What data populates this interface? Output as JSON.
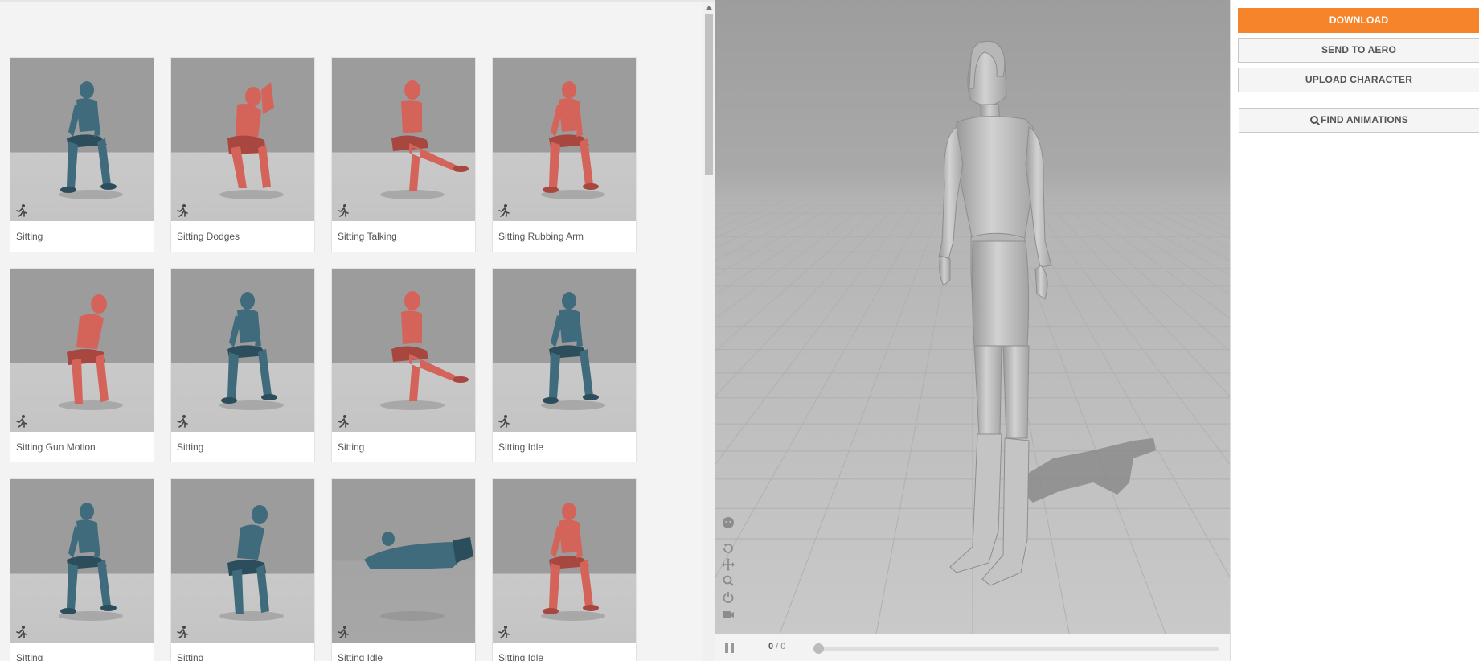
{
  "animations": [
    {
      "label": "Sitting",
      "color": "teal",
      "pose": "sit",
      "scene": "light"
    },
    {
      "label": "Sitting Dodges",
      "color": "red",
      "pose": "dodge",
      "scene": "light"
    },
    {
      "label": "Sitting Talking",
      "color": "red",
      "pose": "cross",
      "scene": "light"
    },
    {
      "label": "Sitting Rubbing Arm",
      "color": "red",
      "pose": "sit",
      "scene": "light"
    },
    {
      "label": "Sitting Gun Motion",
      "color": "red",
      "pose": "lean",
      "scene": "light"
    },
    {
      "label": "Sitting",
      "color": "teal",
      "pose": "sit",
      "scene": "light"
    },
    {
      "label": "Sitting",
      "color": "red",
      "pose": "cross",
      "scene": "light"
    },
    {
      "label": "Sitting Idle",
      "color": "teal",
      "pose": "sit",
      "scene": "light"
    },
    {
      "label": "Sitting",
      "color": "teal",
      "pose": "sit",
      "scene": "light"
    },
    {
      "label": "Sitting",
      "color": "teal",
      "pose": "lean",
      "scene": "light"
    },
    {
      "label": "Sitting Idle",
      "color": "teal",
      "pose": "lying",
      "scene": "dark"
    },
    {
      "label": "Sitting Idle",
      "color": "red",
      "pose": "sit",
      "scene": "light"
    }
  ],
  "colors": {
    "teal": "#3f6b7d",
    "teal_dark": "#2c4d5b",
    "red": "#d4645a",
    "red_dark": "#a8473f",
    "accent": "#f5842a"
  },
  "card_icon": "running-figure-icon",
  "player": {
    "current_frame": "0",
    "separator": " / ",
    "total_frames": "0",
    "progress": 0
  },
  "viewport_tools": [
    "face-icon",
    "rotate-icon",
    "move-icon",
    "zoom-icon",
    "power-icon",
    "camera-icon"
  ],
  "actions": {
    "download": "DOWNLOAD",
    "send_to_aero": "SEND TO AERO",
    "upload_character": "UPLOAD CHARACTER",
    "find_animations": "FIND ANIMATIONS"
  }
}
